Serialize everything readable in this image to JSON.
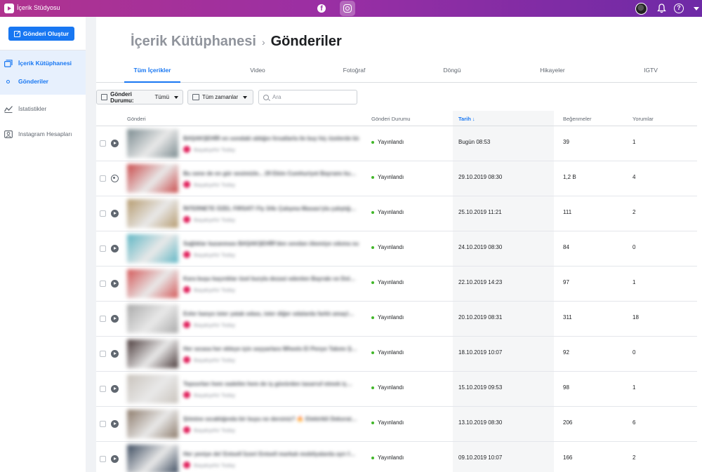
{
  "app": {
    "title": "İçerik Stüdyosu",
    "platforms": [
      {
        "name": "facebook",
        "icon": "facebook-icon",
        "glyph": "f",
        "active": false
      },
      {
        "name": "instagram",
        "icon": "instagram-icon",
        "active": true
      }
    ],
    "header_icons": [
      "avatar",
      "bell-icon",
      "help-icon",
      "chevron-down-icon"
    ],
    "help_glyph": "?",
    "accent_color": "#1877f2",
    "header_gradient": [
      "#b0338f",
      "#6e2aa6"
    ]
  },
  "sidebar": {
    "create_button": "Gönderi Oluştur",
    "items": [
      {
        "label": "İçerik Kütüphanesi",
        "icon": "library-icon",
        "active": true
      },
      {
        "label": "Gönderiler",
        "icon": "dot-icon",
        "active": true
      },
      {
        "label": "İstatistikler",
        "icon": "chart-icon",
        "active": false
      },
      {
        "label": "Instagram Hesapları",
        "icon": "account-icon",
        "active": false
      }
    ]
  },
  "breadcrumb": {
    "parent": "İçerik Kütüphanesi",
    "separator": "›",
    "current": "Gönderiler"
  },
  "tabs": [
    {
      "label": "Tüm İçerikler",
      "active": true
    },
    {
      "label": "Video",
      "active": false
    },
    {
      "label": "Fotoğraf",
      "active": false
    },
    {
      "label": "Döngü",
      "active": false
    },
    {
      "label": "Hikayeler",
      "active": false
    },
    {
      "label": "IGTV",
      "active": false
    }
  ],
  "filters": {
    "status_label": "Gönderi Durumu:",
    "status_value": "Tümü",
    "time_label": "Tüm zamanlar",
    "search_placeholder": "Ara"
  },
  "table": {
    "headers": {
      "post": "Gönderi",
      "status": "Gönderi Durumu",
      "date": "Tarih ↓",
      "likes": "Beğenmeler",
      "comments": "Yorumlar"
    },
    "rows": [
      {
        "type": "video",
        "text": "BAŞAKŞEHİR en sondaki aldığın fırsatlarla ile buy hiç özelerde bir…",
        "meta": "Başakşehir Today",
        "status": "Yayınlandı",
        "date": "Bugün 08:53",
        "likes": "39",
        "comments": "1",
        "thumb": "#7a8a8f"
      },
      {
        "type": "photo",
        "text": "Bu sene de en gür sesimizle... 29 Ekim Cumhuriyet Bayramı ku…",
        "meta": "Başakşehir Today",
        "status": "Yayınlandı",
        "date": "29.10.2019 08:30",
        "likes": "1,2 B",
        "comments": "4",
        "thumb": "#c94a4a"
      },
      {
        "type": "video",
        "text": "İNTERNETE ÖZEL FIRSAT! Fly 3/4c Çalışma Masası'yla çalıştığ…",
        "meta": "Başakşehir Today",
        "status": "Yayınlandı",
        "date": "25.10.2019 11:21",
        "likes": "111",
        "comments": "2",
        "thumb": "#b59a6e"
      },
      {
        "type": "video",
        "text": "Sağlıklar kazanması BAŞAKŞEHİR'den sevdan ökemiye sıkıma su…",
        "meta": "Başakşehir Today",
        "status": "Yayınlandı",
        "date": "24.10.2019 08:30",
        "likes": "84",
        "comments": "0",
        "thumb": "#5fb6c4"
      },
      {
        "type": "video",
        "text": "Kara buşu kaçırdılar özel buryla dezasi edenlen Bayrakı ve Dol…",
        "meta": "Başakşehir Today",
        "status": "Yayınlandı",
        "date": "22.10.2019 14:23",
        "likes": "97",
        "comments": "1",
        "thumb": "#d35757"
      },
      {
        "type": "video",
        "text": "Evler banyo ister yatak odası, ister diğer odalarda farklı amaçl…",
        "meta": "Başakşehir Today",
        "status": "Yayınlandı",
        "date": "20.10.2019 08:31",
        "likes": "311",
        "comments": "18",
        "thumb": "#a9a9a9"
      },
      {
        "type": "video",
        "text": "Her sıcasa her ekleye için seyyarlara Wheels El Penye Takımı Ş…",
        "meta": "Başakşehir Today",
        "status": "Yayınlandı",
        "date": "18.10.2019 10:07",
        "likes": "92",
        "comments": "0",
        "thumb": "#4a3a3a"
      },
      {
        "type": "video",
        "text": "Tepsorları hem vadelim hem de iş güvürden tasarruf etmek iç…",
        "meta": "Başakşehir Today",
        "status": "Yayınlandı",
        "date": "15.10.2019 09:53",
        "likes": "98",
        "comments": "1",
        "thumb": "#c9c3bc"
      },
      {
        "type": "video",
        "text": "Şömine sıcaklığında bir buyu ne dersiniz? 🔥 Elektrikli Dekorat…",
        "meta": "Başakşehir Today",
        "status": "Yayınlandı",
        "date": "13.10.2019 08:30",
        "likes": "206",
        "comments": "6",
        "thumb": "#8c7a6a"
      },
      {
        "type": "video",
        "text": "Her yeniye de! Entsell İzzeri Entsell markalı mobilyalarda ayrı f…",
        "meta": "Başakşehir Today",
        "status": "Yayınlandı",
        "date": "09.10.2019 10:07",
        "likes": "166",
        "comments": "2",
        "thumb": "#3b4a5e"
      }
    ]
  }
}
